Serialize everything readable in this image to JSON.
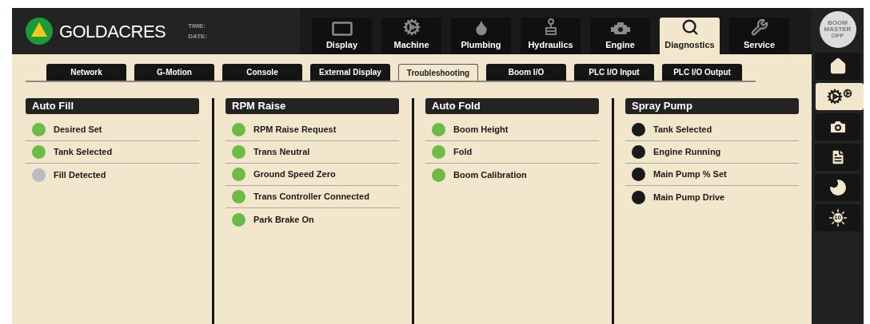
{
  "brand": {
    "name": "GOLDACRES",
    "time_label": "TIME:",
    "date_label": "DATE:"
  },
  "nav_tabs": [
    {
      "label": "Display",
      "selected": false
    },
    {
      "label": "Machine",
      "selected": false
    },
    {
      "label": "Plumbing",
      "selected": false
    },
    {
      "label": "Hydraulics",
      "selected": false
    },
    {
      "label": "Engine",
      "selected": false
    },
    {
      "label": "Diagnostics",
      "selected": true
    },
    {
      "label": "Service",
      "selected": false
    }
  ],
  "sub_tabs": [
    {
      "label": "Network",
      "selected": false
    },
    {
      "label": "G-Motion",
      "selected": false
    },
    {
      "label": "Console",
      "selected": false
    },
    {
      "label": "External Display",
      "selected": false
    },
    {
      "label": "Troubleshooting",
      "selected": true
    },
    {
      "label": "Boom I/O",
      "selected": false
    },
    {
      "label": "PLC I/O Input",
      "selected": false
    },
    {
      "label": "PLC I/O Output",
      "selected": false
    }
  ],
  "panels": [
    {
      "title": "Auto Fill",
      "items": [
        {
          "label": "Desired Set",
          "color": "#6cbb46"
        },
        {
          "label": "Tank Selected",
          "color": "#6cbb46"
        },
        {
          "label": "Fill Detected",
          "color": "#bcbcbe"
        }
      ]
    },
    {
      "title": "RPM Raise",
      "items": [
        {
          "label": "RPM Raise Request",
          "color": "#6cbb46"
        },
        {
          "label": "Trans Neutral",
          "color": "#6cbb46"
        },
        {
          "label": "Ground Speed Zero",
          "color": "#6cbb46"
        },
        {
          "label": "Trans Controller Connected",
          "color": "#6cbb46"
        },
        {
          "label": "Park Brake On",
          "color": "#6cbb46"
        }
      ]
    },
    {
      "title": "Auto Fold",
      "items": [
        {
          "label": "Boom Height",
          "color": "#6cbb46"
        },
        {
          "label": "Fold",
          "color": "#6cbb46"
        },
        {
          "label": "Boom Calibration",
          "color": "#6cbb46"
        }
      ]
    },
    {
      "title": "Spray Pump",
      "items": [
        {
          "label": "Tank Selected",
          "color": "#1a1a1a"
        },
        {
          "label": "Engine Running",
          "color": "#1a1a1a"
        },
        {
          "label": "Main Pump % Set",
          "color": "#1a1a1a"
        },
        {
          "label": "Main Pump Drive",
          "color": "#1a1a1a"
        }
      ]
    }
  ],
  "boom_master": {
    "label": "BOOM MASTER OFF"
  },
  "side_buttons": [
    {
      "selected": false
    },
    {
      "selected": true
    },
    {
      "selected": false
    },
    {
      "selected": false
    },
    {
      "selected": false
    },
    {
      "selected": false,
      "text": "10"
    }
  ]
}
